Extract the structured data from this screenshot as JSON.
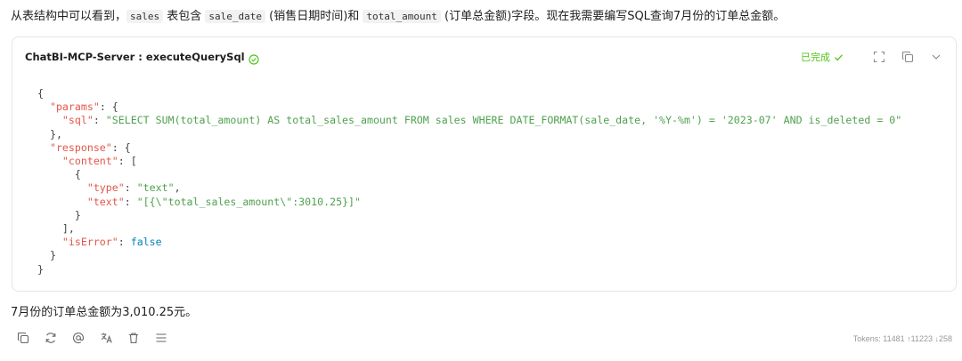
{
  "message": {
    "intro_prefix": "从表结构中可以看到，",
    "intro_code1": "sales",
    "intro_mid1": " 表包含 ",
    "intro_code2": "sale_date",
    "intro_mid2": " (销售日期时间)和 ",
    "intro_code3": "total_amount",
    "intro_suffix": " (订单总金额)字段。现在我需要编写SQL查询7月份的订单总金额。",
    "answer": "7月份的订单总金额为3,010.25元。"
  },
  "tool_call": {
    "title": "ChatBI-MCP-Server : executeQuerySql",
    "status": "已完成",
    "sql": "\"SELECT SUM(total_amount) AS total_sales_amount FROM sales WHERE DATE_FORMAT(sale_date, '%Y-%m') = '2023-07' AND is_deleted = 0\"",
    "type_value": "\"text\"",
    "text_value": "\"[{\\\"total_sales_amount\\\":3010.25}]\"",
    "is_error_value": "false",
    "keys": {
      "params": "\"params\"",
      "sql": "\"sql\"",
      "response": "\"response\"",
      "content": "\"content\"",
      "type": "\"type\"",
      "text": "\"text\"",
      "isError": "\"isError\""
    }
  },
  "footer": {
    "tokens": "Tokens: 11481 ↑11223 ↓258"
  },
  "icons": {
    "status_check": "check-icon",
    "header_actions": [
      "expand-icon",
      "copy-icon",
      "chevron-down-icon"
    ],
    "toolbar": [
      "copy-icon",
      "refresh-icon",
      "at-icon",
      "translate-icon",
      "trash-icon",
      "menu-icon"
    ]
  },
  "colors": {
    "success": "#52c41a",
    "json_key": "#e45649",
    "json_string": "#50a14f",
    "json_boolean": "#0184bc"
  }
}
